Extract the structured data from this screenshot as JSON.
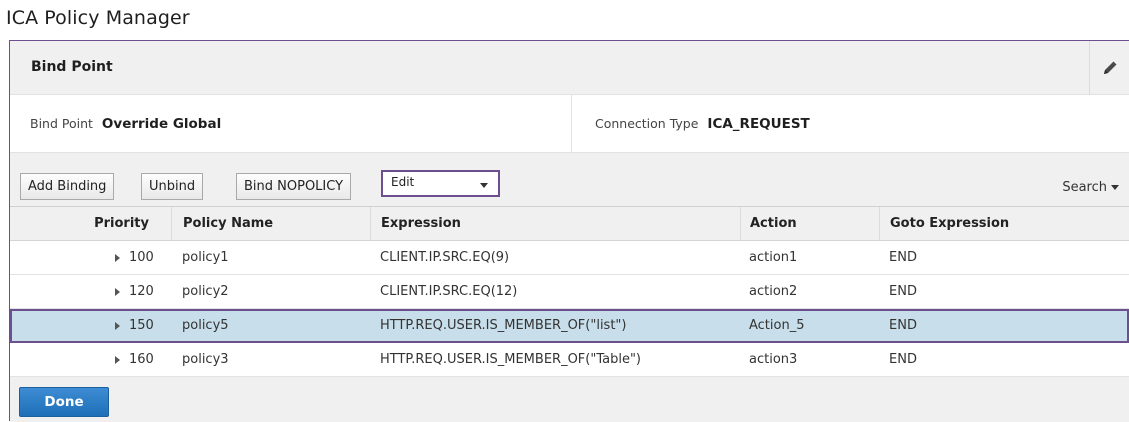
{
  "page": {
    "title": "ICA Policy Manager"
  },
  "bind_point_section": {
    "title": "Bind Point",
    "bind_point_label": "Bind Point",
    "bind_point_value": "Override Global",
    "connection_type_label": "Connection Type",
    "connection_type_value": "ICA_REQUEST",
    "edit_icon": "pencil-icon"
  },
  "toolbar": {
    "add_binding_label": "Add Binding",
    "unbind_label": "Unbind",
    "bind_nopolicy_label": "Bind NOPOLICY",
    "edit_select_value": "Edit",
    "search_label": "Search"
  },
  "table": {
    "columns": [
      "Priority",
      "Policy Name",
      "Expression",
      "Action",
      "Goto Expression"
    ],
    "rows": [
      {
        "priority": "100",
        "policy_name": "policy1",
        "expression": "CLIENT.IP.SRC.EQ(9)",
        "action": "action1",
        "goto": "END",
        "selected": false
      },
      {
        "priority": "120",
        "policy_name": "policy2",
        "expression": "CLIENT.IP.SRC.EQ(12)",
        "action": "action2",
        "goto": "END",
        "selected": false
      },
      {
        "priority": "150",
        "policy_name": "policy5",
        "expression": "HTTP.REQ.USER.IS_MEMBER_OF(\"list\")",
        "action": "Action_5",
        "goto": "END",
        "selected": true
      },
      {
        "priority": "160",
        "policy_name": "policy3",
        "expression": "HTTP.REQ.USER.IS_MEMBER_OF(\"Table\")",
        "action": "action3",
        "goto": "END",
        "selected": false
      }
    ]
  },
  "footer": {
    "done_label": "Done"
  },
  "colors": {
    "accent_border": "#6b4f8f",
    "selected_row": "#c8dfeb",
    "primary_button": "#2a7cc7"
  }
}
